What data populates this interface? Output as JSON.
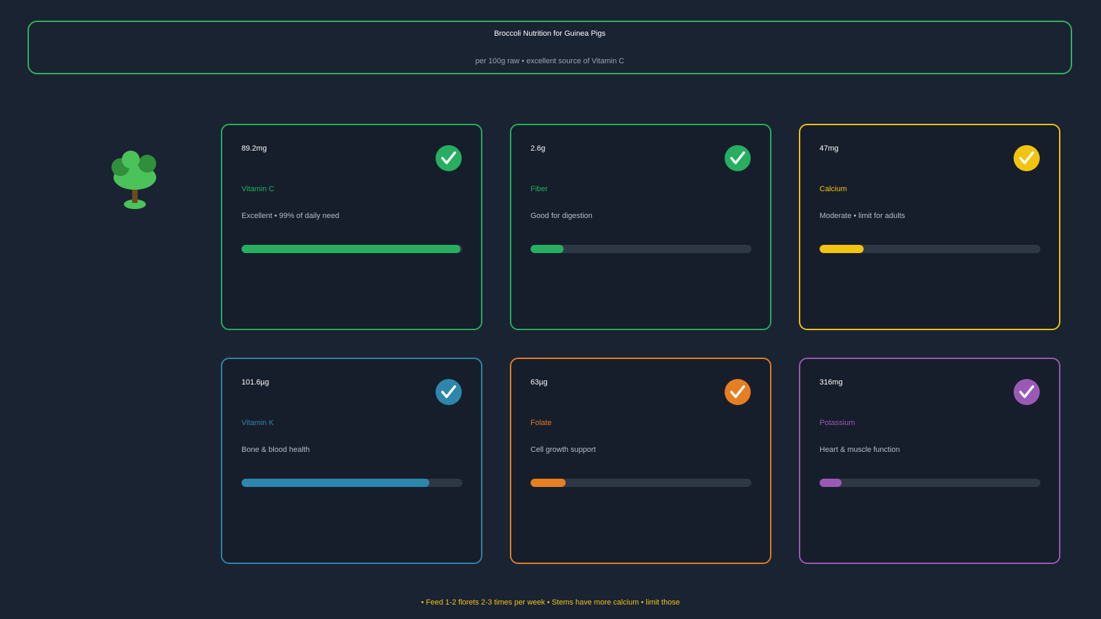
{
  "header": {
    "title": "Broccoli Nutrition for Guinea Pigs",
    "subtitle": "per 100g raw • excellent source of Vitamin C",
    "border_color": "#2fb35f"
  },
  "illustration": {
    "icon": "broccoli-icon"
  },
  "cards": [
    {
      "amount": "89.2mg",
      "name": "Vitamin C",
      "description": "Excellent • 99% of daily need",
      "color": "#27ae60",
      "level": 0.99,
      "icon": "check-icon"
    },
    {
      "amount": "2.6g",
      "name": "Fiber",
      "description": "Good for digestion",
      "color": "#27ae60",
      "level": 0.15,
      "icon": "check-icon"
    },
    {
      "amount": "47mg",
      "name": "Calcium",
      "description": "Moderate • limit for adults",
      "color": "#f1c40f",
      "level": 0.2,
      "icon": "check-icon"
    },
    {
      "amount": "101.6µg",
      "name": "Vitamin K",
      "description": "Bone & blood health",
      "color": "#2e86ab",
      "level": 0.85,
      "icon": "check-icon"
    },
    {
      "amount": "63µg",
      "name": "Folate",
      "description": "Cell growth support",
      "color": "#e67e22",
      "level": 0.16,
      "icon": "check-icon"
    },
    {
      "amount": "316mg",
      "name": "Potassium",
      "description": "Heart & muscle function",
      "color": "#9b59b6",
      "level": 0.1,
      "icon": "check-icon"
    }
  ],
  "footer": {
    "text": "• Feed 1-2 florets 2-3 times per week • Stems have more calcium • limit those",
    "color": "#f2c31a"
  }
}
